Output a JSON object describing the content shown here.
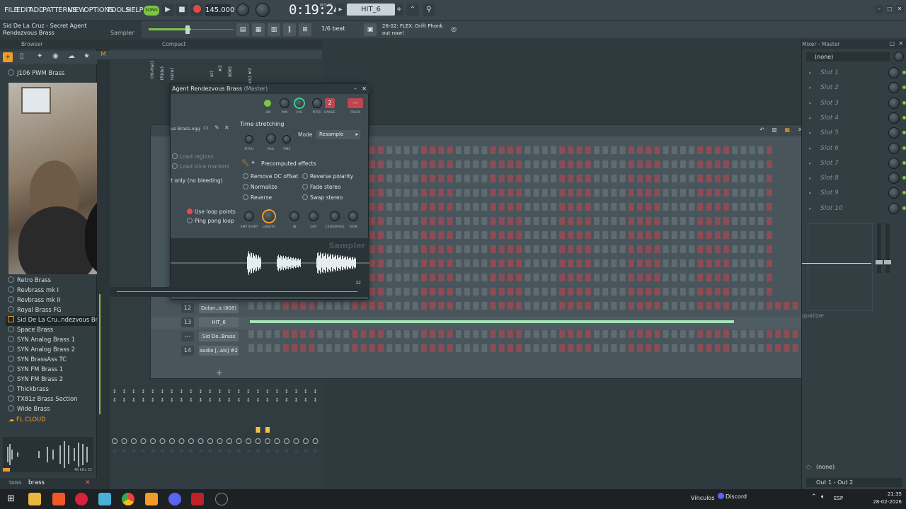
{
  "menu": [
    "FILE",
    "EDIT",
    "ADD",
    "PATTERNS",
    "VIEW",
    "OPTIONS",
    "TOOLS",
    "HELP"
  ],
  "transport": {
    "song_label": "SONG",
    "tempo": "145.000",
    "time": "0:19:24",
    "time_unit": "M:S:CS",
    "pattern": "HIT_6"
  },
  "hint": {
    "line1": "Sid De La Cruz - Secret Agent",
    "line2": "Rendezvous Brass",
    "right": "Sampler"
  },
  "toolbar": {
    "snap": "1/6 beat",
    "news_date": "26-02",
    "news_title": "FLEX: Drift Phonk",
    "news_sub": "out now!"
  },
  "browser": {
    "title": "Browser",
    "items": [
      "J106 PWM Brass",
      "Retro Brass",
      "Revbrass mk I",
      "Revbrass mk II",
      "Royal Brass FG",
      "Sid De La Cru..ndezvous Brass",
      "Space Brass",
      "SYN Analog Brass 1",
      "SYN Analog Brass 2",
      "SYN BrassAss TC",
      "SYN FM Brass 1",
      "SYN FM Brass 2",
      "Thickbrass",
      "TX81z Brass Section",
      "Wide Brass"
    ],
    "cloud": "FL CLOUD",
    "sample_info": "48 kHz 32",
    "tags_label": "TAGS",
    "search_value": "brass"
  },
  "compact_label": "Compact",
  "sampler": {
    "title": "Agent Rendezvous Brass",
    "title_suffix": "(Master)",
    "knobs": [
      "ON",
      "PAN",
      "VOL",
      "PITCH",
      "RANGE",
      "TRACK"
    ],
    "track_num": "2",
    "file": "us Brass.ogg",
    "load_regions": "Load regions",
    "load_slices": "Load slice markers",
    "mode_partial": "t only (no bleeding)",
    "time_stretch": "Time stretching",
    "ts_knobs": [
      "PITCH",
      "MUL",
      "TIME"
    ],
    "mode_label": "Mode",
    "mode_value": "Resample",
    "precomputed": "Precomputed effects",
    "effects_left": [
      "Remove DC offset",
      "Normalize",
      "Reverse"
    ],
    "effects_right": [
      "Reverse polarity",
      "Fade stereo",
      "Swap stereo"
    ],
    "loop_points": "Use loop points",
    "ping_pong": "Ping pong loop",
    "env_knobs": [
      "SMP START",
      "LENGTH",
      "IN",
      "OUT",
      "CROSSFADE",
      "TRIM"
    ],
    "watermark": "Sampler",
    "res": "32"
  },
  "channels": [
    {
      "num": "12",
      "name": "Dolan..a (808)"
    },
    {
      "num": "13",
      "name": "HIT_6"
    },
    {
      "num": "---",
      "name": "Sid De..Brass"
    },
    {
      "num": "14",
      "name": "audio [..als] #2"
    }
  ],
  "ch_headers": [
    "(Hi-Hat)",
    "(Ride)",
    "nare)",
    "at)",
    "#2",
    "808)",
    "als) #2"
  ],
  "mixer": {
    "title": "Mixer - Master",
    "none_top": "(none)",
    "slots": [
      "Slot 1",
      "Slot 2",
      "Slot 3",
      "Slot 4",
      "Slot 5",
      "Slot 6",
      "Slot 7",
      "Slot 8",
      "Slot 9",
      "Slot 10"
    ],
    "equalizer": "qualizer",
    "none_bottom": "(none)",
    "output": "Out 1 - Out 2"
  },
  "taskbar": {
    "vinculos": "Vínculos",
    "discord": "Discord",
    "lang": "ESP",
    "time": "21:35",
    "date": "28-02-2026"
  },
  "colors": {
    "accent": "#f39c25",
    "step_red": "#8c4c55",
    "step_gray": "#5f6b70",
    "green": "#7cc644",
    "active_lane": "#a2e3b7"
  }
}
